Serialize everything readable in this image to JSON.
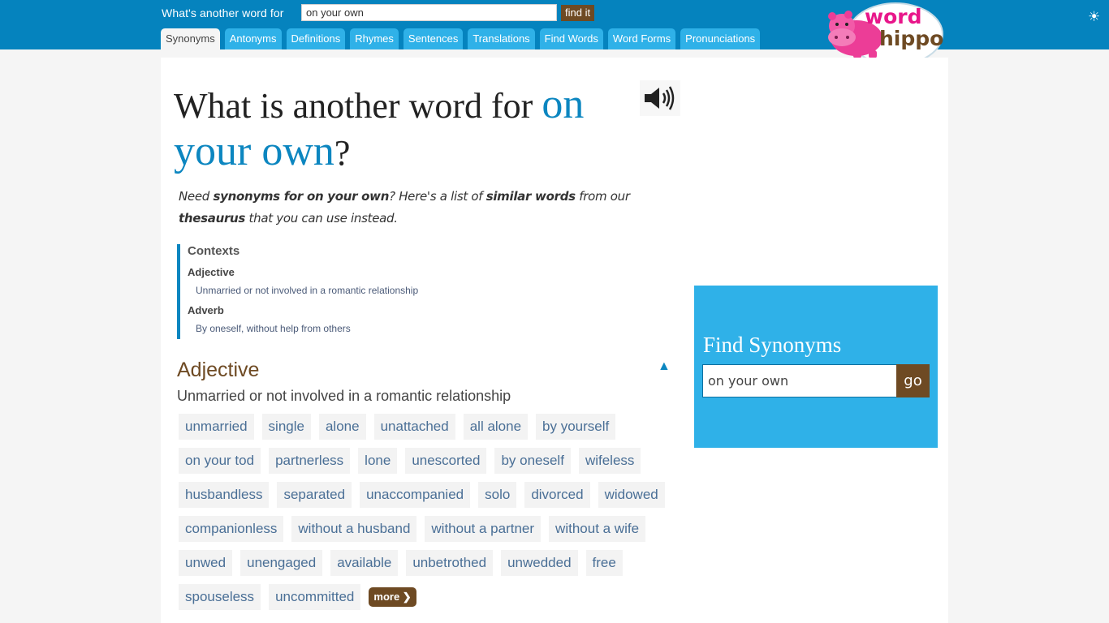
{
  "header": {
    "search_label": "What's another word for",
    "search_value": "on your own",
    "find_button": "find it",
    "theme_icon": "sun-icon",
    "logo_text_top": "word",
    "logo_text_bottom": "hippo",
    "tabs": [
      {
        "label": "Synonyms",
        "active": true
      },
      {
        "label": "Antonyms"
      },
      {
        "label": "Definitions"
      },
      {
        "label": "Rhymes"
      },
      {
        "label": "Sentences"
      },
      {
        "label": "Translations"
      },
      {
        "label": "Find Words"
      },
      {
        "label": "Word Forms"
      },
      {
        "label": "Pronunciations"
      }
    ]
  },
  "main": {
    "title_prefix": "What is another word for ",
    "title_term": "on your own",
    "title_suffix": "?",
    "speaker_icon": "speaker-icon",
    "intro": {
      "p1": "Need ",
      "b1": "synonyms for on your own",
      "p2": "? Here's a list of ",
      "b2": "similar words",
      "p3": " from our ",
      "b3": "thesaurus",
      "p4": " that you can use instead."
    },
    "contexts": {
      "heading": "Contexts",
      "items": [
        {
          "pos": "Adjective",
          "definition": "Unmarried or not involved in a romantic relationship"
        },
        {
          "pos": "Adverb",
          "definition": "By oneself, without help from others"
        }
      ]
    },
    "section": {
      "title": "Adjective",
      "definition": "Unmarried or not involved in a romantic relationship",
      "collapse_icon": "triangle-up-icon",
      "words": [
        "unmarried",
        "single",
        "alone",
        "unattached",
        "all alone",
        "by yourself",
        "on your tod",
        "partnerless",
        "lone",
        "unescorted",
        "by oneself",
        "wifeless",
        "husbandless",
        "separated",
        "unaccompanied",
        "solo",
        "divorced",
        "widowed",
        "companionless",
        "without a husband",
        "without a partner",
        "without a wife",
        "unwed",
        "unengaged",
        "available",
        "unbetrothed",
        "unwedded",
        "free",
        "spouseless",
        "uncommitted"
      ],
      "more_label": "more ❯"
    }
  },
  "sidebar": {
    "find_title": "Find Synonyms",
    "find_value": "on your own",
    "go_label": "go"
  },
  "colors": {
    "header_blue": "#0583be",
    "tab_blue": "#2fb1e8",
    "accent_blue": "#0c86c0",
    "brown": "#6e4a23",
    "hippo_pink": "#ec3d97"
  }
}
